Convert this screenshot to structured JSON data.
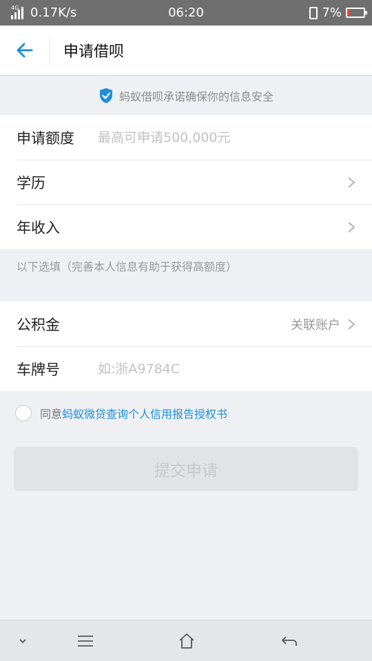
{
  "status_bar": {
    "network_type": "4G",
    "speed": "0.17K/s",
    "time": "06:20",
    "battery": "7%"
  },
  "header": {
    "title": "申请借呗"
  },
  "security_notice": "蚂蚁借呗承诺确保你的信息安全",
  "form": {
    "amount_label": "申请额度",
    "amount_placeholder": "最高可申请500,000元",
    "education_label": "学历",
    "income_label": "年收入",
    "optional_note": "以下选填（完善本人信息有助于获得高额度）",
    "fund_label": "公积金",
    "fund_value": "关联账户",
    "plate_label": "车牌号",
    "plate_placeholder": "如:浙A9784C"
  },
  "agreement": {
    "prefix": "同意",
    "link": "蚂蚁微贷查询个人信用报告授权书"
  },
  "submit_label": "提交申请",
  "colors": {
    "accent": "#1f8fd8",
    "background": "#eff0f4",
    "battery_low": "#ff3b30"
  }
}
